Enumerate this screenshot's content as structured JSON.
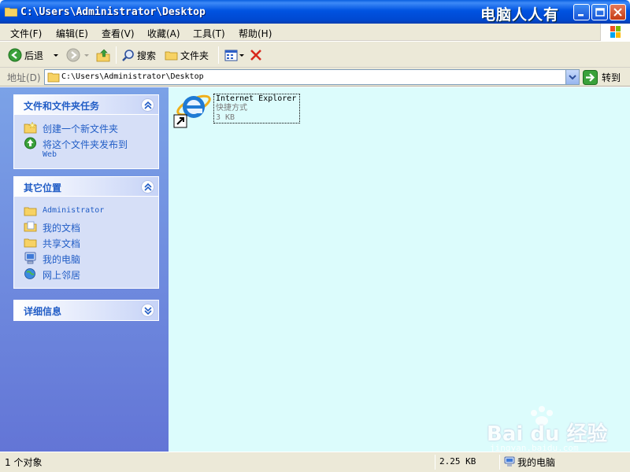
{
  "window": {
    "title": "C:\\Users\\Administrator\\Desktop",
    "watermark": "电脑人人有"
  },
  "menu": {
    "items": [
      "文件(F)",
      "编辑(E)",
      "查看(V)",
      "收藏(A)",
      "工具(T)",
      "帮助(H)"
    ]
  },
  "toolbar": {
    "back_label": "后退",
    "search_label": "搜索",
    "folders_label": "文件夹"
  },
  "address": {
    "label": "地址(D)",
    "value": "C:\\Users\\Administrator\\Desktop",
    "go_label": "转到"
  },
  "sidebar": {
    "tasks_panel": {
      "title": "文件和文件夹任务",
      "items": [
        {
          "label": "创建一个新文件夹",
          "icon": "new-folder-icon"
        },
        {
          "label": "将这个文件夹发布到",
          "label2": "Web",
          "icon": "publish-web-icon"
        }
      ]
    },
    "places_panel": {
      "title": "其它位置",
      "items": [
        {
          "label": "Administrator",
          "icon": "folder-icon"
        },
        {
          "label": "我的文档",
          "icon": "my-documents-icon"
        },
        {
          "label": "共享文档",
          "icon": "shared-documents-icon"
        },
        {
          "label": "我的电脑",
          "icon": "my-computer-icon"
        },
        {
          "label": "网上邻居",
          "icon": "network-places-icon"
        }
      ]
    },
    "details_panel": {
      "title": "详细信息"
    }
  },
  "files": [
    {
      "name": "Internet Explorer",
      "type": "快捷方式",
      "size": "3 KB",
      "icon": "internet-explorer-icon"
    }
  ],
  "watermark": {
    "brand": "Bai du 经验",
    "sub": "jingyan.baidu.com"
  },
  "status": {
    "object_count": "1 个对象",
    "size": "2.25 KB",
    "location": "我的电脑"
  },
  "colors": {
    "title_bar": "#0053e1",
    "content_bg": "#dcfcfc",
    "sidebar_link": "#215dc6",
    "chrome": "#ece9d8"
  }
}
